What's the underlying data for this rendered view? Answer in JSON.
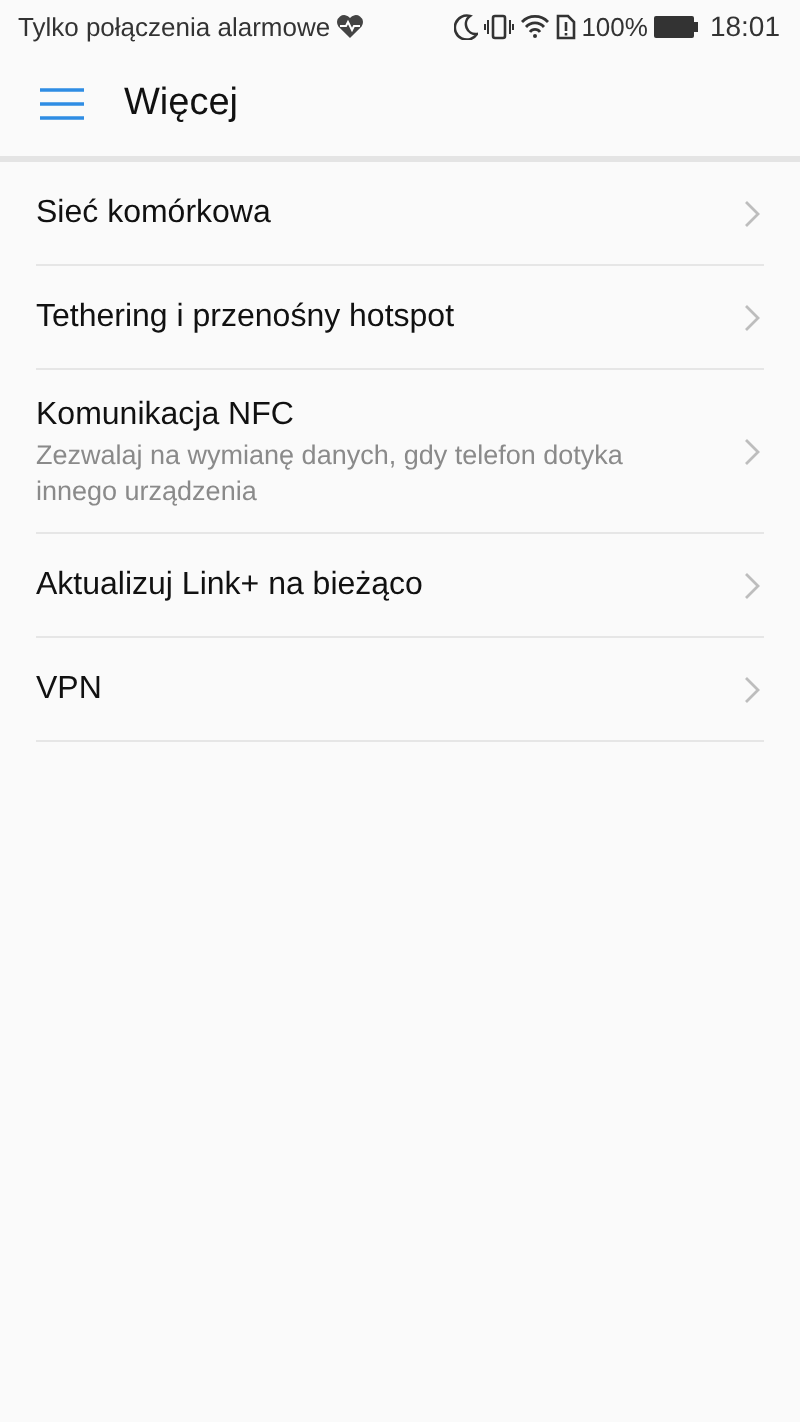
{
  "status_bar": {
    "carrier": "Tylko połączenia alarmowe",
    "battery_percent": "100%",
    "time": "18:01"
  },
  "header": {
    "title": "Więcej"
  },
  "items": [
    {
      "title": "Sieć komórkowa"
    },
    {
      "title": "Tethering i przenośny hotspot"
    },
    {
      "title": "Komunikacja NFC",
      "subtitle": "Zezwalaj na wymianę danych, gdy telefon dotyka innego urządzenia"
    },
    {
      "title": "Aktualizuj Link+ na bieżąco"
    },
    {
      "title": "VPN"
    }
  ]
}
